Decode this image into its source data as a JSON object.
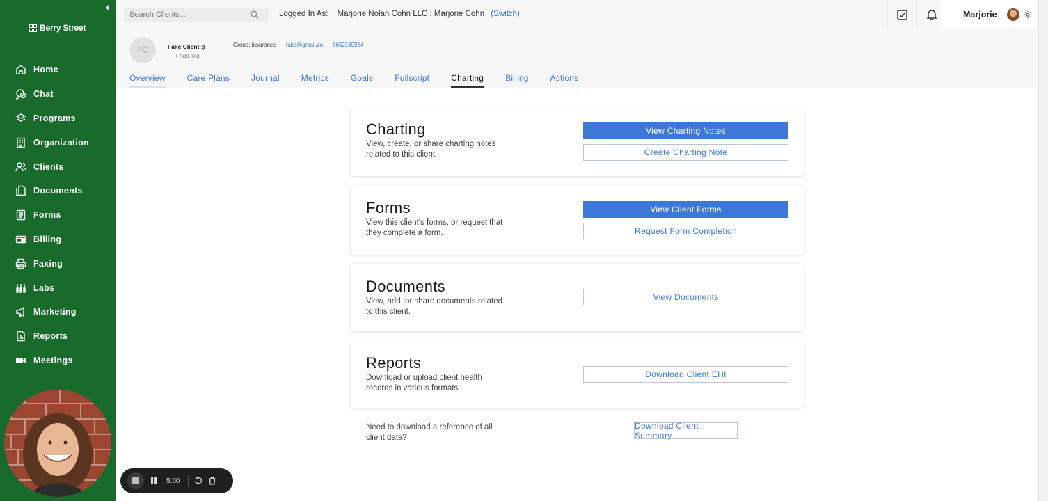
{
  "sidebar": {
    "brand": "Berry Street",
    "items": [
      {
        "label": "Home",
        "icon": "home-icon"
      },
      {
        "label": "Chat",
        "icon": "chat-icon"
      },
      {
        "label": "Programs",
        "icon": "programs-icon"
      },
      {
        "label": "Organization",
        "icon": "organization-icon"
      },
      {
        "label": "Clients",
        "icon": "clients-icon"
      },
      {
        "label": "Documents",
        "icon": "documents-icon"
      },
      {
        "label": "Forms",
        "icon": "forms-icon"
      },
      {
        "label": "Billing",
        "icon": "billing-icon"
      },
      {
        "label": "Faxing",
        "icon": "fax-icon"
      },
      {
        "label": "Labs",
        "icon": "labs-icon"
      },
      {
        "label": "Marketing",
        "icon": "megaphone-icon"
      },
      {
        "label": "Reports",
        "icon": "reports-icon"
      },
      {
        "label": "Meetings",
        "icon": "video-icon"
      }
    ]
  },
  "topbar": {
    "search_placeholder": "Search Clients...",
    "logged_in_label": "Logged In As:",
    "logged_in_value": "Marjorie Nolan Cohn LLC : Marjorie Cohn",
    "switch_label": "(Switch)",
    "user_name": "Marjorie"
  },
  "client": {
    "initials": "FC",
    "name": "Fake Client :)",
    "add_tag": "+ Add Tag",
    "group": "Group: insurance",
    "email": "fake@gmail.co",
    "phone": "8652169984"
  },
  "tabs": [
    "Overview",
    "Care Plans",
    "Journal",
    "Metrics",
    "Goals",
    "Fullscript",
    "Charting",
    "Billing",
    "Actions"
  ],
  "active_tab": "Charting",
  "cards": {
    "charting": {
      "title": "Charting",
      "description": "View, create, or share charting notes related to this client.",
      "primary": "View Charting Notes",
      "secondary": "Create Charting Note"
    },
    "forms": {
      "title": "Forms",
      "description": "View this client's forms, or request that they complete a form.",
      "primary": "View Client Forms",
      "secondary": "Request Form Completion"
    },
    "documents": {
      "title": "Documents",
      "description": "View, add, or share documents related to this client.",
      "secondary": "View Documents"
    },
    "reports": {
      "title": "Reports",
      "description": "Download or upload client health records in various formats.",
      "secondary": "Download Client EHI"
    }
  },
  "footer": {
    "text": "Need to download a reference of all client data?",
    "button": "Download Client Summary"
  },
  "recorder": {
    "time": "5:00"
  },
  "colors": {
    "sidebar": "#196b2c",
    "accent": "#3b78d8"
  }
}
